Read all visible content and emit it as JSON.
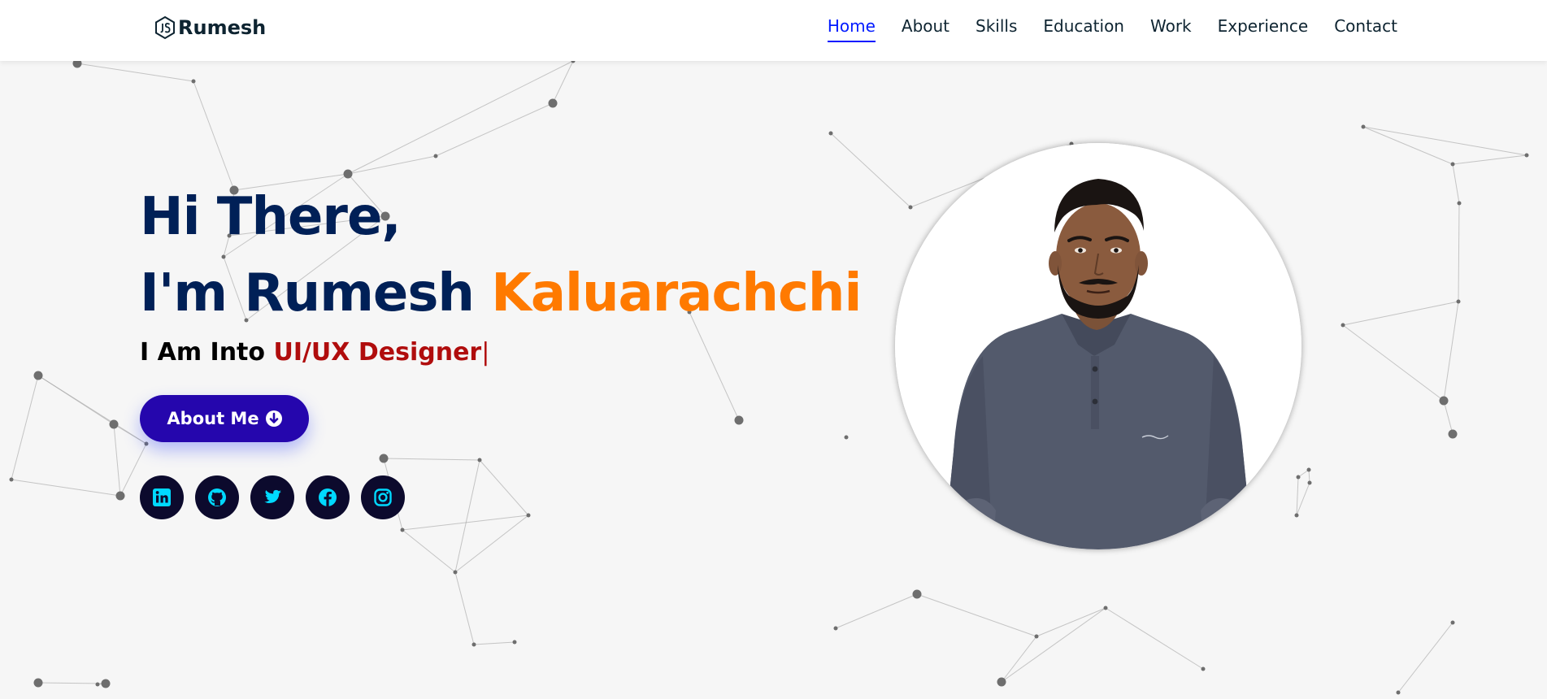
{
  "brand": {
    "name": "Rumesh",
    "icon": "js-hexagon-icon"
  },
  "nav": {
    "items": [
      {
        "label": "Home",
        "active": true
      },
      {
        "label": "About",
        "active": false
      },
      {
        "label": "Skills",
        "active": false
      },
      {
        "label": "Education",
        "active": false
      },
      {
        "label": "Work",
        "active": false
      },
      {
        "label": "Experience",
        "active": false
      },
      {
        "label": "Contact",
        "active": false
      }
    ]
  },
  "hero": {
    "greeting_line1": "Hi There,",
    "greeting_line2_prefix": "I'm Rumesh ",
    "greeting_line2_surname": "Kaluarachchi",
    "intro_prefix": "I Am Into ",
    "intro_role": "UI/UX Designer",
    "intro_caret": "|",
    "button_label": "About Me",
    "button_icon": "arrow-circle-down-icon"
  },
  "socials": [
    {
      "name": "linkedin",
      "icon": "linkedin-icon"
    },
    {
      "name": "github",
      "icon": "github-icon"
    },
    {
      "name": "twitter",
      "icon": "twitter-icon"
    },
    {
      "name": "facebook",
      "icon": "facebook-icon"
    },
    {
      "name": "instagram",
      "icon": "instagram-icon"
    }
  ],
  "colors": {
    "nav_active": "#011aff",
    "heading": "#002057",
    "surname": "#ff7a00",
    "role": "#b00d0d",
    "button": "#2506ad",
    "social_bg": "#0c0a2d",
    "social_icon": "#00d9ff",
    "background": "#f6f6f6"
  }
}
